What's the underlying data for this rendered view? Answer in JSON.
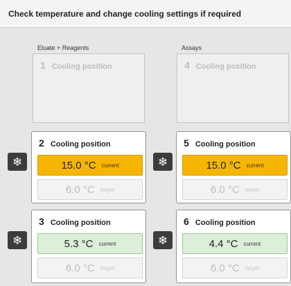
{
  "header": {
    "title": "Check temperature and change cooling settings if required"
  },
  "columns": [
    {
      "label": "Eluate + Reagents"
    },
    {
      "label": "Assays"
    }
  ],
  "positions": [
    {
      "number": "1",
      "label": "Cooling position",
      "state": "disabled"
    },
    {
      "number": "4",
      "label": "Cooling position",
      "state": "disabled"
    },
    {
      "number": "2",
      "label": "Cooling position",
      "current": "15.0 °C",
      "current_tag": "current",
      "target": "6.0 °C",
      "target_tag": "target",
      "status_color": "#f6b600"
    },
    {
      "number": "5",
      "label": "Cooling position",
      "current": "15.0 °C",
      "current_tag": "current",
      "target": "6.0 °C",
      "target_tag": "target",
      "status_color": "#f6b600"
    },
    {
      "number": "3",
      "label": "Cooling position",
      "current": "5.3 °C",
      "current_tag": "current",
      "target": "6.0 °C",
      "target_tag": "target",
      "status_color": "#dcefd8"
    },
    {
      "number": "6",
      "label": "Cooling position",
      "current": "4.4 °C",
      "current_tag": "current",
      "target": "6.0 °C",
      "target_tag": "target",
      "status_color": "#dcefd8"
    }
  ],
  "icons": {
    "cooling": "snowflake-icon"
  },
  "cooling_glyph": "❄"
}
